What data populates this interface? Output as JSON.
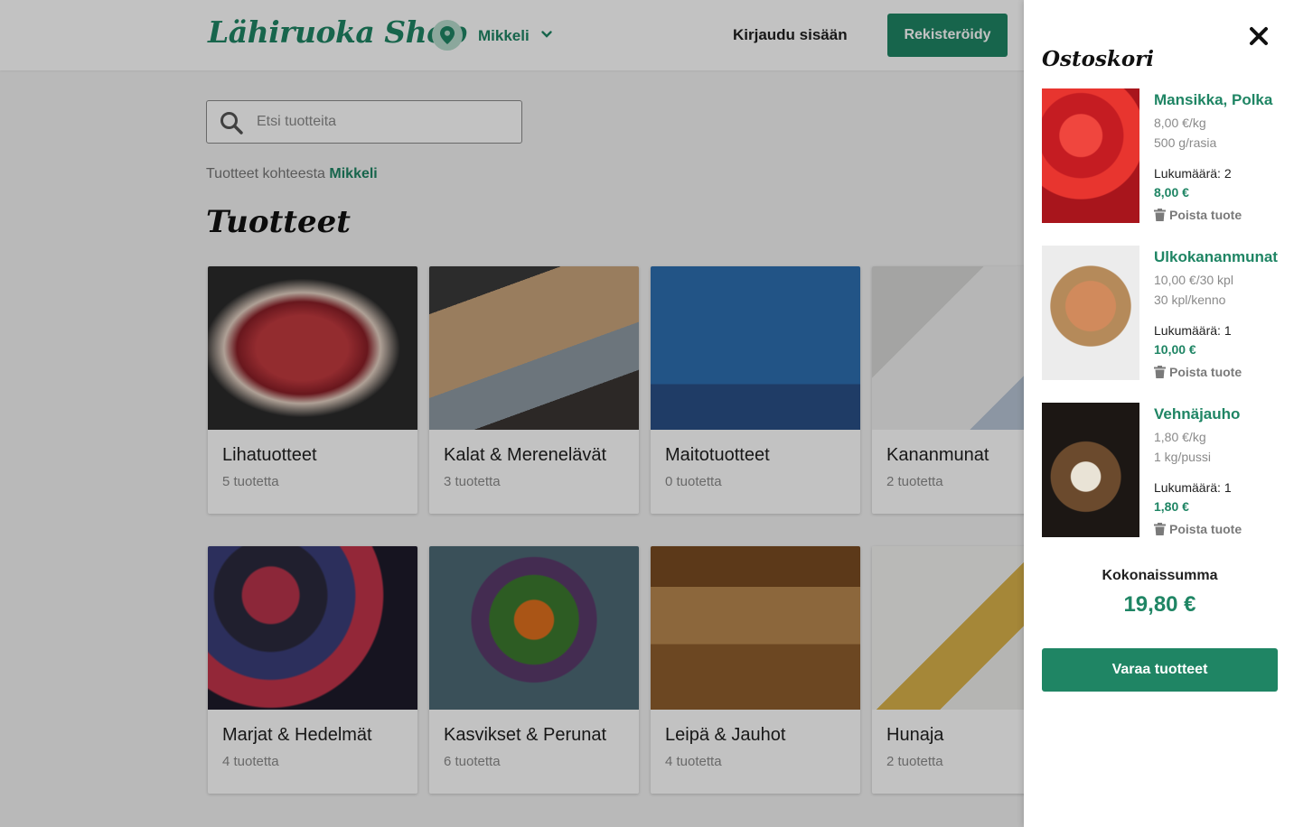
{
  "header": {
    "logo": "Lähiruoka Shop",
    "location": "Mikkeli",
    "login_label": "Kirjaudu sisään",
    "register_label": "Rekisteröidy"
  },
  "search": {
    "placeholder": "Etsi tuotteita",
    "value": ""
  },
  "location_line": {
    "prefix": "Tuotteet kohteesta",
    "place": "Mikkeli"
  },
  "section_title": "Tuotteet",
  "categories": [
    {
      "name": "Lihatuotteet",
      "count": "5 tuotetta"
    },
    {
      "name": "Kalat & Merenelävät",
      "count": "3 tuotetta"
    },
    {
      "name": "Maitotuotteet",
      "count": "0 tuotetta"
    },
    {
      "name": "Kananmunat",
      "count": "2 tuotetta"
    },
    {
      "name": "Marjat & Hedelmät",
      "count": "4 tuotetta"
    },
    {
      "name": "Kasvikset & Perunat",
      "count": "6 tuotetta"
    },
    {
      "name": "Leipä & Jauhot",
      "count": "4 tuotetta"
    },
    {
      "name": "Hunaja",
      "count": "2 tuotetta"
    }
  ],
  "cart": {
    "title": "Ostoskori",
    "items": [
      {
        "name": "Mansikka, Polka",
        "price": "8,00 €/kg",
        "unit": "500 g/rasia",
        "quantity": "Lukumäärä: 2",
        "total": "8,00 €",
        "remove_label": "Poista tuote"
      },
      {
        "name": "Ulkokananmunat",
        "price": "10,00 €/30 kpl",
        "unit": "30 kpl/kenno",
        "quantity": "Lukumäärä: 1",
        "total": "10,00 €",
        "remove_label": "Poista tuote"
      },
      {
        "name": "Vehnäjauho",
        "price": "1,80 €/kg",
        "unit": "1 kg/pussi",
        "quantity": "Lukumäärä: 1",
        "total": "1,80 €",
        "remove_label": "Poista tuote"
      }
    ],
    "total_label": "Kokonaissumma",
    "total_value": "19,80 €",
    "reserve_label": "Varaa tuotteet"
  },
  "colors": {
    "brand": "#1f8564",
    "brand_light": "#b7dccd",
    "muted": "#8a8a8a"
  },
  "icons": [
    "location-pin-icon",
    "chevron-down-icon",
    "search-icon",
    "close-icon",
    "trash-icon"
  ]
}
